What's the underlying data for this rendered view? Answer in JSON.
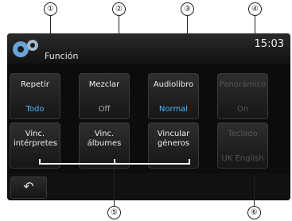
{
  "header": {
    "title": "Función",
    "clock": "15:03"
  },
  "callouts": [
    "①",
    "②",
    "③",
    "④",
    "⑤",
    "⑥"
  ],
  "buttons": [
    {
      "label": "Repetir",
      "value": "Todo"
    },
    {
      "label": "Mezclar",
      "value": "Off"
    },
    {
      "label": "Audiolibro",
      "value": "Normal"
    },
    {
      "label": "Panorámico",
      "value": "On"
    },
    {
      "label": "Vinc. intérpretes",
      "value": ""
    },
    {
      "label": "Vinc. álbumes",
      "value": ""
    },
    {
      "label": "Vincular géneros",
      "value": ""
    },
    {
      "label": "Teclado",
      "value": "UK English"
    }
  ],
  "footer": {
    "back_icon": "back-arrow-icon",
    "back_glyph": "↶"
  }
}
